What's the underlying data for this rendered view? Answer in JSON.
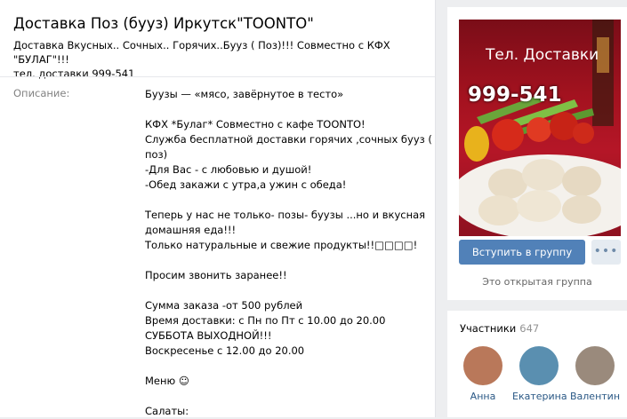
{
  "group": {
    "title": "Доставка Поз (бууз) Иркутск\"TOONTO\"",
    "status_line1": "Доставка Вкусных.. Сочных.. Горячих..Бууз ( Поз)!!! Совместно с КФХ \"БУЛАГ\"!!!",
    "status_line2": "тел. доставки 999-541"
  },
  "info": {
    "label": "Описание:",
    "lines": [
      "Буузы — «мясо, завёрнутое в тесто»",
      "",
      "КФХ *Булаг* Совместно с кафе TOONTO!",
      "Служба бесплатной доставки горячих ,сочных бууз (",
      "поз)",
      "-Для Вас - с любовью и душой!",
      "-Обед закажи с утра,а ужин с обеда!",
      "",
      "Теперь у нас не только- позы- буузы ...но и вкусная",
      "домашняя еда!!!",
      "Только натуральные и свежие продукты!!□□□□!",
      "",
      "Просим звонить заранее!!",
      "",
      "Сумма заказа -от 500 рублей",
      "Время доставки: с Пн по Пт с 10.00 до 20.00",
      "СУББОТА ВЫХОДНОЙ!!!",
      "Воскресенье с 12.00 до 20.00",
      "",
      "Меню ☺",
      "",
      "Салаты:"
    ]
  },
  "cover": {
    "title": "Тел. Доставки",
    "phone": "999-541"
  },
  "actions": {
    "join_label": "Вступить в группу",
    "more_label": "•••",
    "group_type": "Это открытая группа"
  },
  "members": {
    "label": "Участники",
    "count": "647",
    "people": [
      {
        "name": "Анна",
        "color": "#b9785a"
      },
      {
        "name": "Екатерина",
        "color": "#5a8fb0"
      },
      {
        "name": "Валентин",
        "color": "#9a8a7c"
      }
    ]
  }
}
